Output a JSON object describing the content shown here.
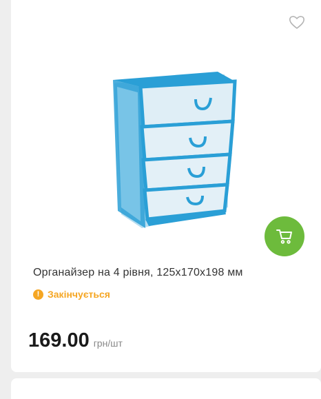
{
  "product": {
    "title": "Органайзер на 4 рівня, 125х170х198 мм",
    "status": "Закінчується",
    "status_icon": "exclamation-icon",
    "price": "169.00",
    "unit": "грн/шт"
  },
  "icons": {
    "favorite": "heart-outline-icon",
    "cart": "shopping-cart-icon"
  },
  "colors": {
    "accent_green": "#6dbb3c",
    "status_orange": "#f5a623",
    "product_blue": "#2a9fd6"
  }
}
